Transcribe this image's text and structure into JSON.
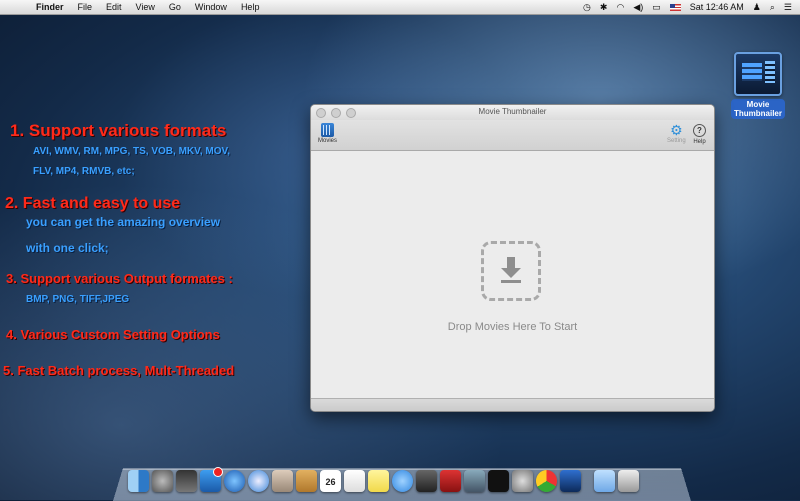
{
  "menubar": {
    "app": "Finder",
    "items": [
      "File",
      "Edit",
      "View",
      "Go",
      "Window",
      "Help"
    ],
    "clock": "Sat 12:46 AM"
  },
  "features": {
    "f1_title": "1. Support various formats",
    "f1_line1": "AVI, WMV, RM, MPG, TS, VOB, MKV, MOV,",
    "f1_line2": "FLV, MP4, RMVB, etc;",
    "f2_title": "2. Fast and easy to use",
    "f2_line1": "you can get the amazing overview",
    "f2_line2": "with one click;",
    "f3_title": "3. Support various Output formates :",
    "f3_line1": "BMP, PNG, TIFF,JPEG",
    "f4_title": "4. Various Custom Setting Options",
    "f5_title": "5. Fast Batch process, Mult-Threaded"
  },
  "desktop_icon": {
    "label_line1": "Movie",
    "label_line2": "Thumbnailer"
  },
  "window": {
    "title": "Movie Thumbnailer",
    "toolbar": {
      "movies": "Movies",
      "setting": "Setting",
      "help": "Help"
    },
    "drop_text": "Drop Movies Here To Start"
  },
  "dock": {
    "icons": [
      "finder-icon",
      "launchpad-icon",
      "mission-control-icon",
      "app-store-icon",
      "itunes-icon",
      "safari-icon",
      "preview-icon",
      "ibooks-icon",
      "calendar-icon",
      "textedit-icon",
      "notes-icon",
      "messages-icon",
      "facetime-icon",
      "photo-booth-icon",
      "iphoto-icon",
      "terminal-icon",
      "system-preferences-icon",
      "chrome-icon",
      "movie-thumbnailer-icon",
      "downloads-folder-icon",
      "trash-icon"
    ],
    "calendar_day": "26"
  }
}
